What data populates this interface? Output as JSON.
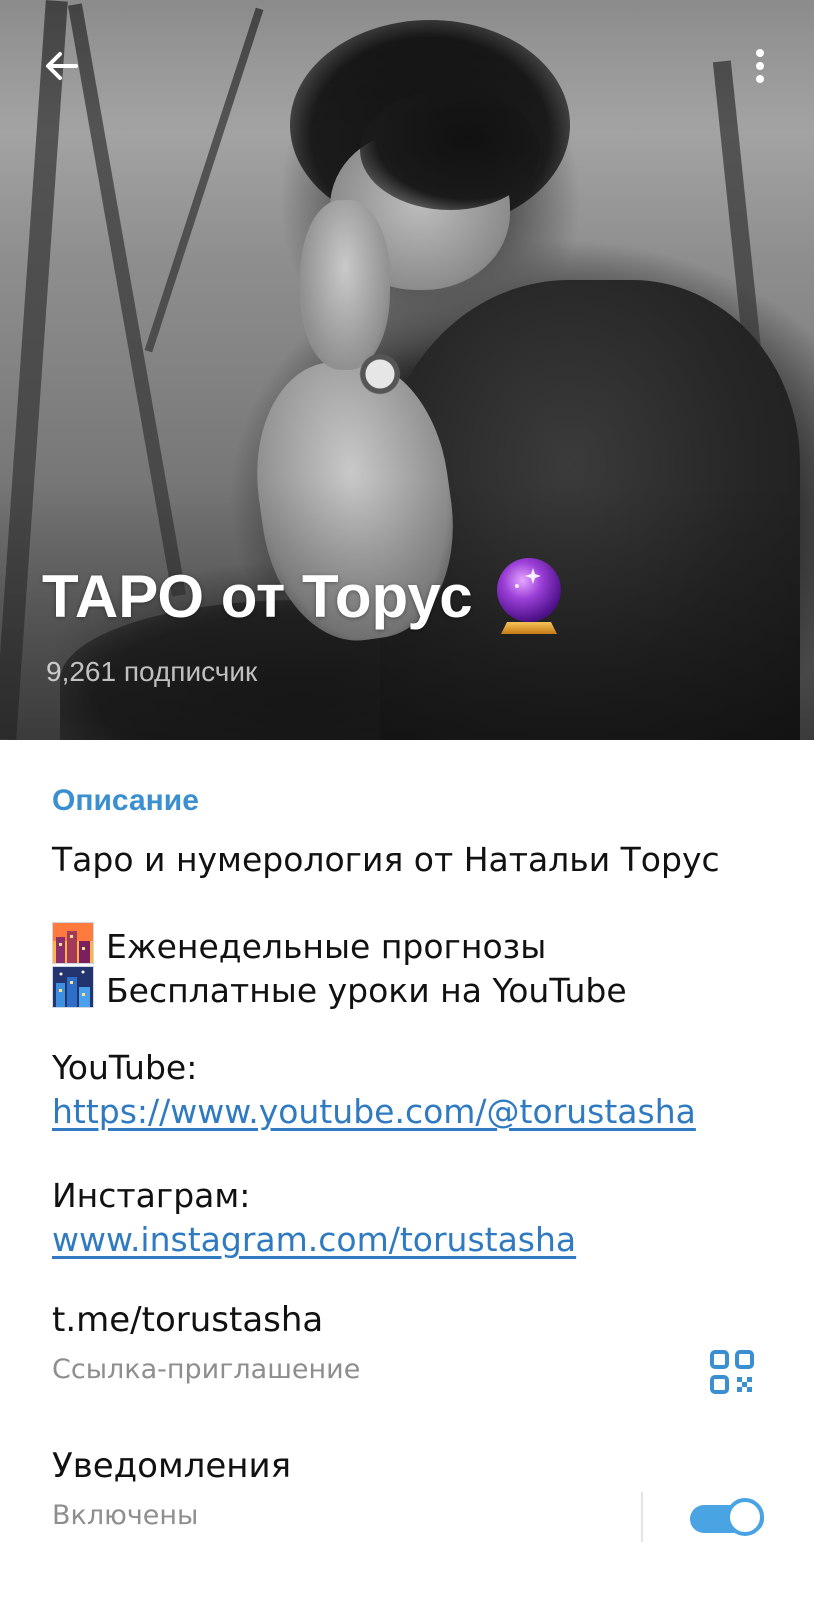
{
  "header": {
    "back_icon": "arrow-left-icon",
    "more_icon": "more-vertical-icon",
    "channel_name": "ТАРО от Торус",
    "channel_emoji": "crystal-ball-icon",
    "subscribers": "9,261 подписчик"
  },
  "description": {
    "section_title": "Описание",
    "intro": "Таро и нумерология от Натальи Торус",
    "bullets": [
      {
        "icon": "city-sunset-icon",
        "text": "Еженедельные прогнозы"
      },
      {
        "icon": "night-city-icon",
        "text": "Бесплатные уроки на YouTube"
      }
    ],
    "youtube_label": "YouTube:",
    "youtube_url": "https://www.youtube.com/@torustasha",
    "instagram_label": "Инстаграм:",
    "instagram_url": "www.instagram.com/torustasha"
  },
  "invite": {
    "link": "t.me/torustasha",
    "label": "Ссылка-приглашение",
    "qr_icon": "qr-code-icon"
  },
  "notifications": {
    "title": "Уведомления",
    "status": "Включены",
    "enabled": true
  },
  "colors": {
    "accent": "#3a8fd0",
    "link": "#2f7ac0",
    "toggle": "#4aa3e2"
  }
}
